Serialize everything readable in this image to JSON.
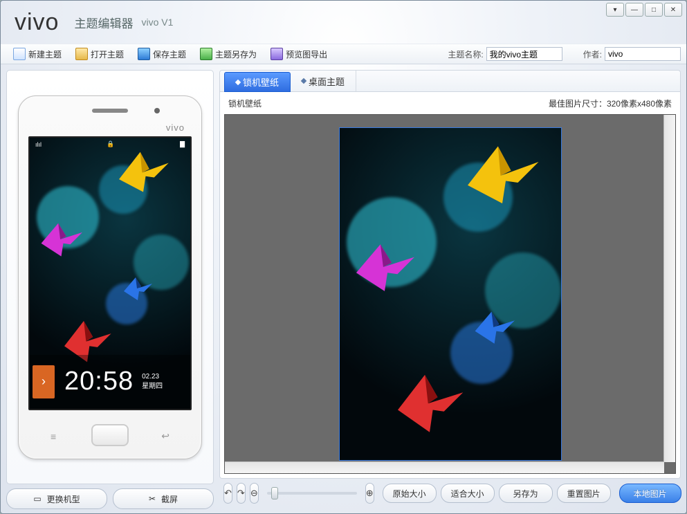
{
  "window_controls": {
    "dropdown": "▾",
    "minimize": "—",
    "maximize": "□",
    "close": "✕"
  },
  "header": {
    "logo_text": "vivo",
    "app_title": "主题编辑器",
    "app_subtitle": "vivo V1"
  },
  "toolbar": {
    "new_theme": "新建主题",
    "open_theme": "打开主题",
    "save_theme": "保存主题",
    "save_as": "主题另存为",
    "export_preview": "预览图导出",
    "theme_name_label": "主题名称:",
    "theme_name_value": "我的vivo主题",
    "author_label": "作者:",
    "author_value": "vivo"
  },
  "left": {
    "change_model": "更换机型",
    "screenshot": "截屏",
    "phone_logo": "vivo",
    "status": {
      "signal": "ılıl",
      "lock": "🔒",
      "battery": "▇"
    },
    "clock": {
      "time": "20:58",
      "date": "02.23",
      "weekday": "星期四",
      "unlock_arrow": "›"
    }
  },
  "tabs": {
    "lock_wallpaper": "锁机壁纸",
    "desktop_theme": "桌面主题"
  },
  "content": {
    "section_label": "锁机壁纸",
    "best_size": "最佳图片尺寸：320像素x480像素"
  },
  "bottom_bar": {
    "undo": "↶",
    "redo": "↷",
    "zoom_out": "⊖",
    "zoom_in": "⊕",
    "original_size": "原始大小",
    "fit_size": "适合大小",
    "save_as": "另存为",
    "reset_image": "重置图片",
    "local_image": "本地图片"
  }
}
